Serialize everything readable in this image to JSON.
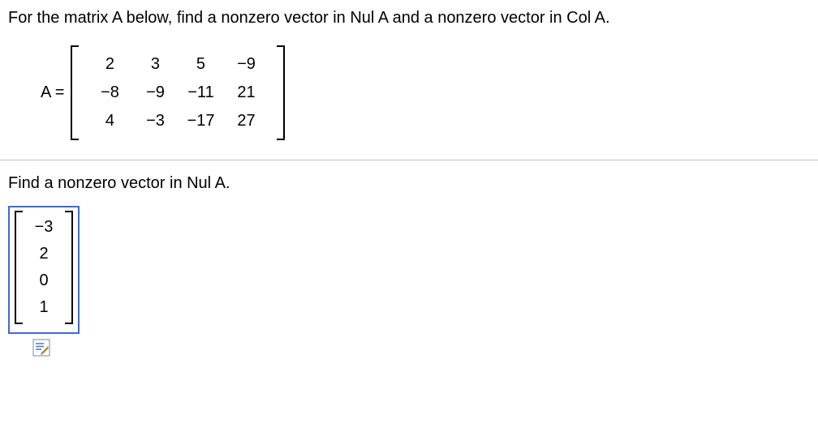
{
  "problem_statement": "For the matrix A below, find a nonzero vector in Nul A and a nonzero vector in Col A.",
  "matrix_label": "A =",
  "matrix_A": {
    "rows": [
      [
        "2",
        "3",
        "5",
        "−9"
      ],
      [
        "−8",
        "−9",
        "−11",
        "21"
      ],
      [
        "4",
        "−3",
        "−17",
        "27"
      ]
    ]
  },
  "subprompt": "Find a nonzero vector in Nul A.",
  "answer_vector": [
    "−3",
    "2",
    "0",
    "1"
  ],
  "icons": {
    "edit": "edit-icon"
  }
}
